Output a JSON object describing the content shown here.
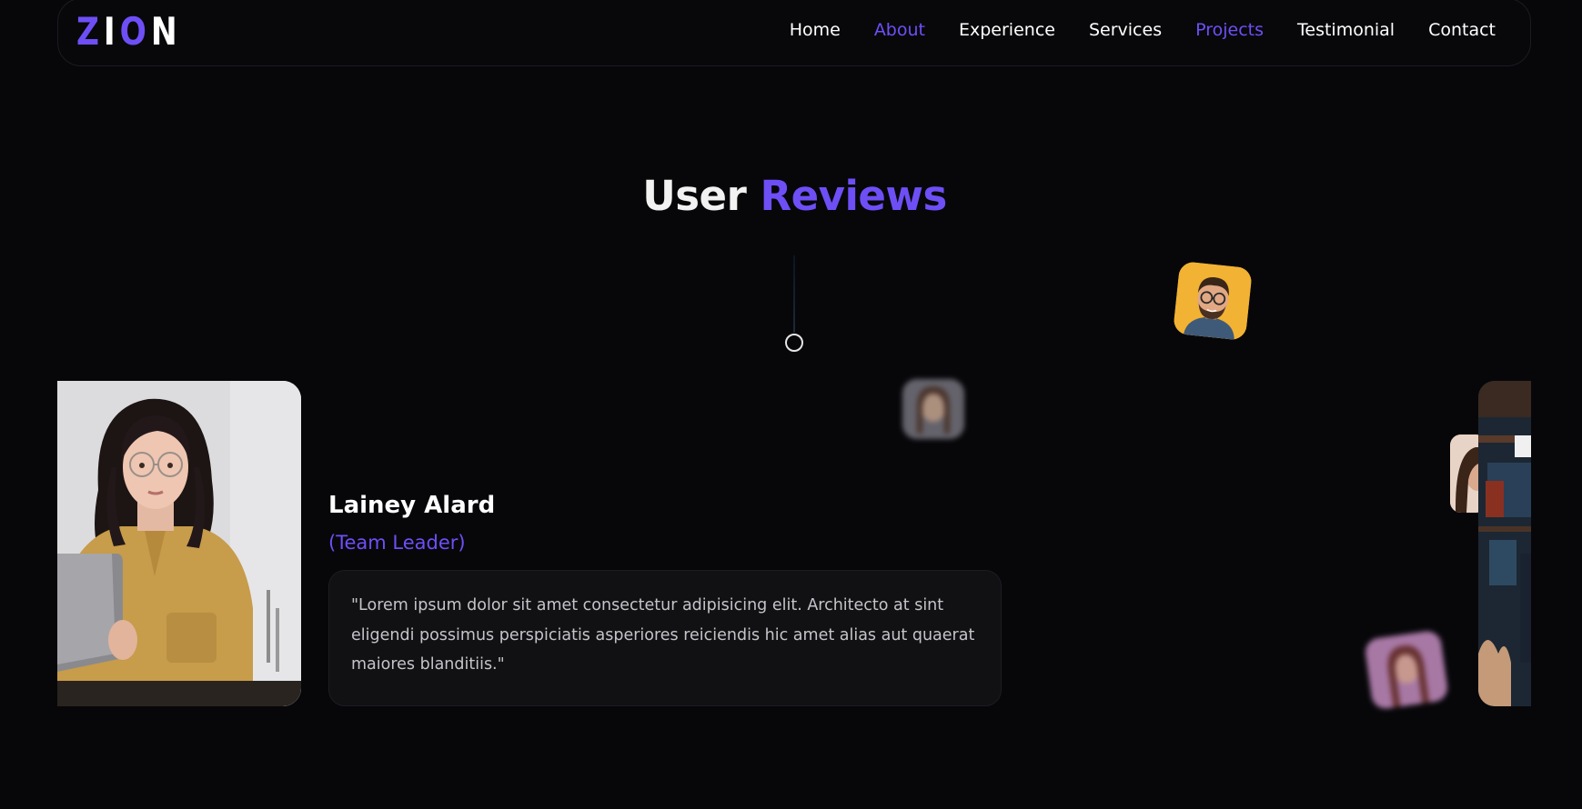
{
  "logo": {
    "letters": [
      "Z",
      "I",
      "O",
      "N"
    ]
  },
  "nav": {
    "items": [
      {
        "label": "Home",
        "accent": false
      },
      {
        "label": "About",
        "accent": true
      },
      {
        "label": "Experience",
        "accent": false
      },
      {
        "label": "Services",
        "accent": false
      },
      {
        "label": "Projects",
        "accent": true
      },
      {
        "label": "Testimonial",
        "accent": false
      },
      {
        "label": "Contact",
        "accent": false
      }
    ]
  },
  "section": {
    "title_part1": "User",
    "title_part2": "Reviews"
  },
  "review": {
    "name": "Lainey Alard",
    "role": "(Team Leader)",
    "text": "\"Lorem ipsum dolor sit amet consectetur adipisicing elit. Architecto at sint eligendi possimus perspiciatis asperiores reiciendis hic amet alias aut quaerat maiores blanditiis.\""
  },
  "colors": {
    "accent": "#6e4ff6",
    "background": "#07070a",
    "card": "#111114",
    "text_muted": "#c4c4c9"
  },
  "icons": {
    "avatar_man": "avatar-man-glasses",
    "avatar_blur_left": "avatar-woman-blurred",
    "avatar_blur_right": "avatar-woman-blurred",
    "timeline": "timeline-dot"
  }
}
